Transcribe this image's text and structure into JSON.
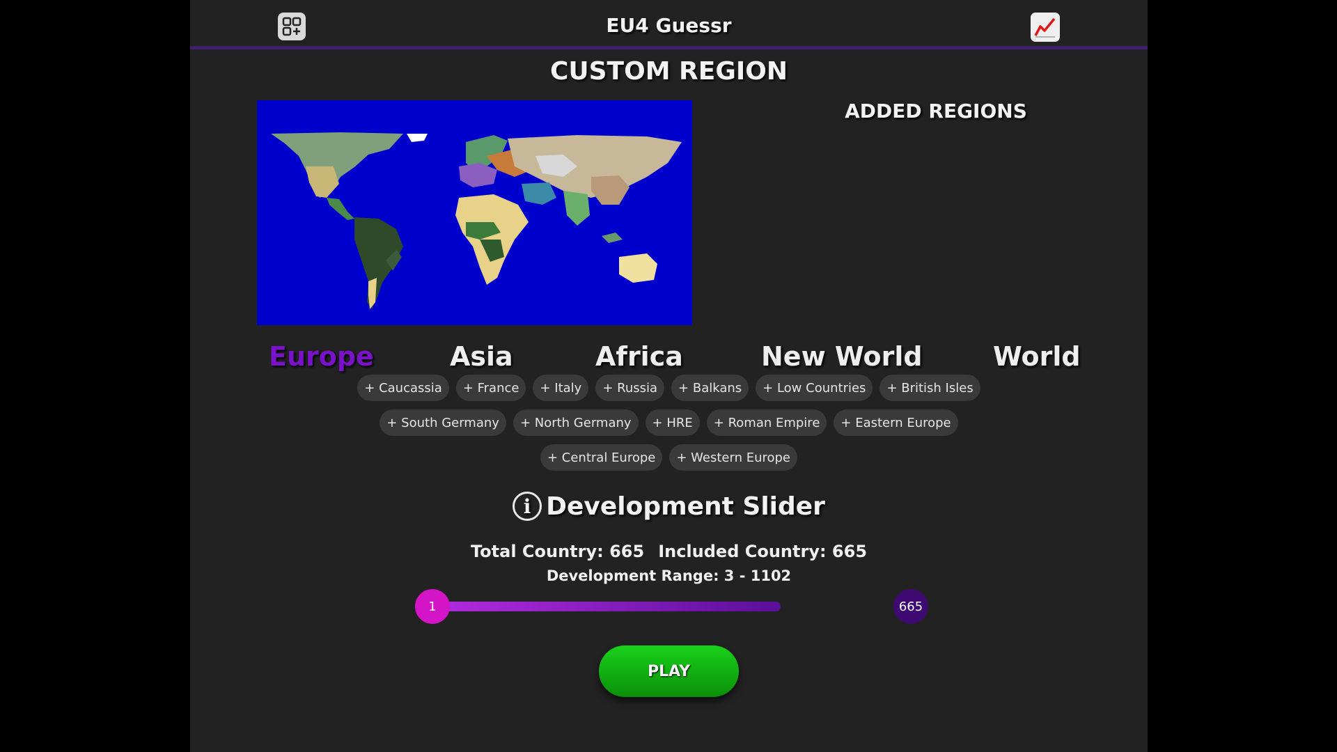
{
  "header": {
    "title": "EU4 Guessr",
    "left_icon": "apps-add-icon",
    "right_icon": "stats-chart-icon"
  },
  "page_title": "CUSTOM REGION",
  "added_regions_title": "ADDED REGIONS",
  "continents": [
    {
      "label": "Europe",
      "active": true
    },
    {
      "label": "Asia",
      "active": false
    },
    {
      "label": "Africa",
      "active": false
    },
    {
      "label": "New World",
      "active": false
    },
    {
      "label": "World",
      "active": false
    }
  ],
  "regions": {
    "row1": [
      "+ Caucassia",
      "+ France",
      "+ Italy",
      "+ Russia",
      "+ Balkans",
      "+ Low Countries",
      "+ British Isles"
    ],
    "row2": [
      "+ South Germany",
      "+ North Germany",
      "+ HRE",
      "+ Roman Empire",
      "+ Eastern Europe"
    ],
    "row3": [
      "+ Central Europe",
      "+ Western Europe"
    ]
  },
  "development": {
    "title": "Development Slider",
    "total_country": "Total Country: 665",
    "included_country": "Included Country: 665",
    "range": "Development Range: 3 - 1102",
    "slider_min": "1",
    "slider_max": "665"
  },
  "play_label": "PLAY",
  "colors": {
    "accent_purple": "#7a12c9",
    "play_green": "#16c016",
    "ocean": "#0000cc"
  }
}
